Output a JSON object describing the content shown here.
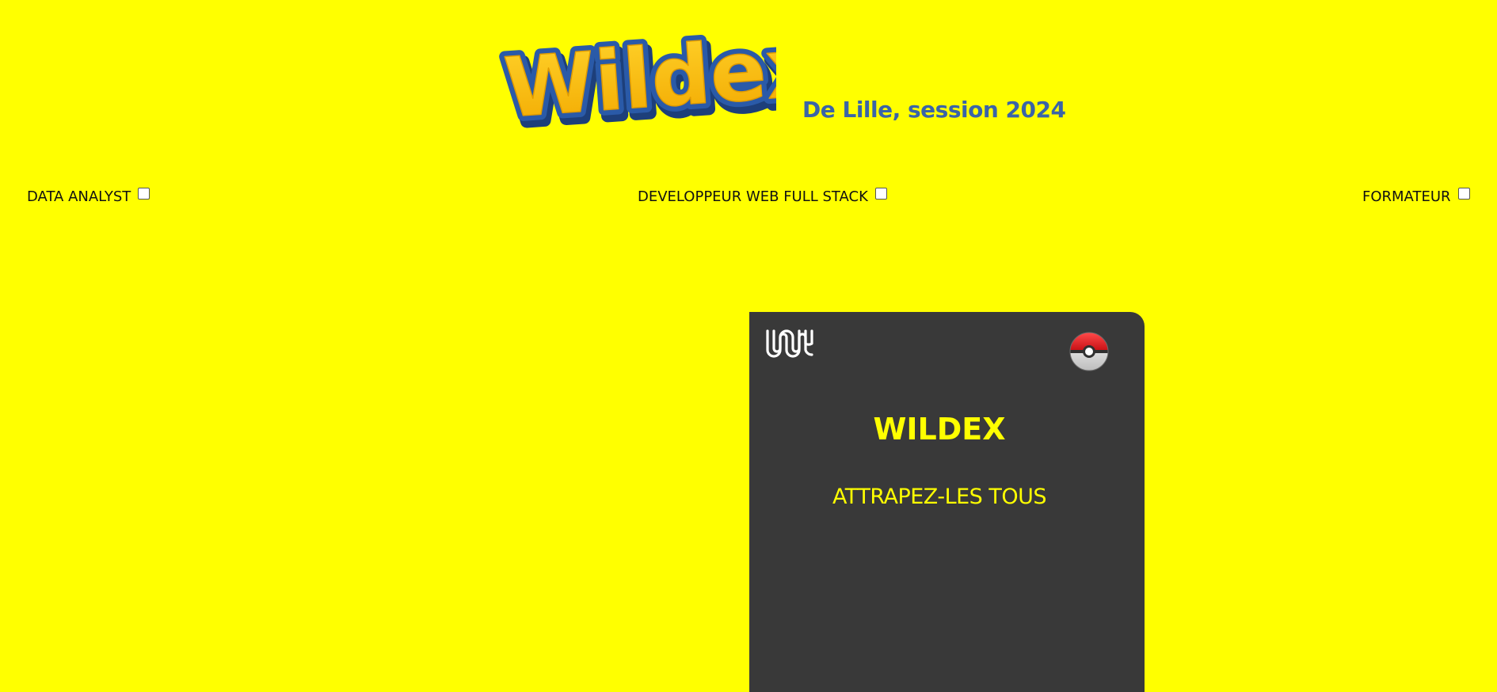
{
  "header": {
    "logo_text": "Wildex",
    "subtitle": "De Lille, session 2024"
  },
  "filters": [
    {
      "label": "DATA ANALYST",
      "checked": false
    },
    {
      "label": "DEVELOPPEUR WEB FULL STACK",
      "checked": false
    },
    {
      "label": "FORMATEUR",
      "checked": false
    }
  ],
  "card": {
    "title": "WILDEX",
    "tagline": "ATTRAPEZ-LES TOUS",
    "icons": [
      "wild-code-school-logo-icon",
      "pokeball-icon"
    ]
  },
  "colors": {
    "background": "#ffff00",
    "card_background": "#393939",
    "card_text": "#ffff00",
    "subtitle": "#3a64a8",
    "logo_fill": "#ffcb05",
    "logo_outline": "#2a5aa8"
  }
}
